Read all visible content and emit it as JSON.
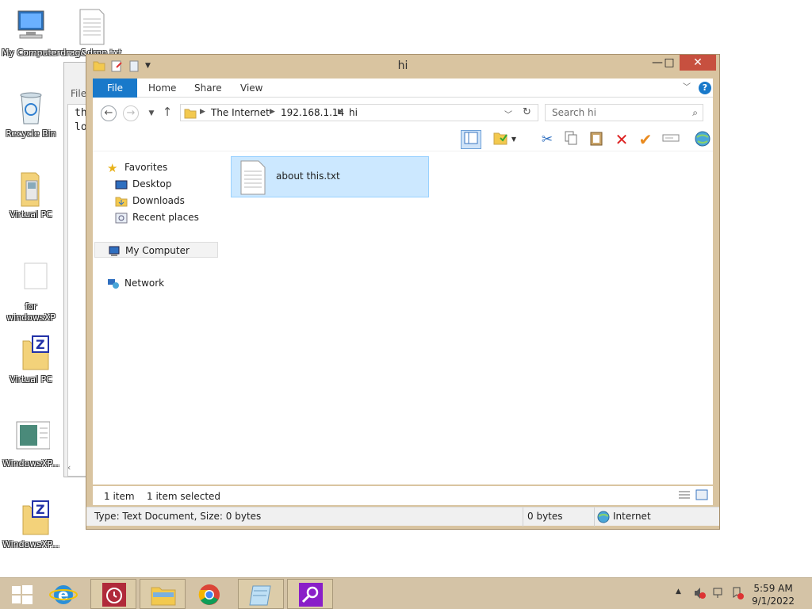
{
  "desktop": {
    "icons": [
      {
        "label": "My Computer"
      },
      {
        "label": "drag&drop.txt"
      },
      {
        "label": "Recycle Bin"
      },
      {
        "label": "Virtual PC"
      },
      {
        "label": "for windowsXP"
      },
      {
        "label": "Virtual PC"
      },
      {
        "label": "WindowsXP..."
      },
      {
        "label": "WindowsXP..."
      }
    ]
  },
  "notepad": {
    "menu": "File",
    "lines": [
      "th",
      "lo"
    ],
    "scroll_arrow": "‹"
  },
  "window": {
    "title": "hi",
    "controls": {
      "minimize": "—",
      "maximize": "□",
      "close": "✕"
    },
    "ribbon_tabs": [
      "File",
      "Home",
      "Share",
      "View"
    ],
    "address": {
      "crumbs": [
        "The Internet",
        "192.168.1.14",
        "hi"
      ],
      "search_placeholder": "Search hi"
    },
    "nav": {
      "favorites": "Favorites",
      "desktop": "Desktop",
      "downloads": "Downloads",
      "recent": "Recent places",
      "computer": "My Computer",
      "network": "Network"
    },
    "files": [
      {
        "name": "about this.txt"
      }
    ],
    "status": {
      "count": "1 item",
      "selected": "1 item selected"
    },
    "details": {
      "type": "Type: Text Document, Size: 0 bytes",
      "size": "0 bytes",
      "zone": "Internet"
    }
  },
  "taskbar": {
    "time": "5:59 AM",
    "date": "9/1/2022"
  },
  "colors": {
    "accent": "#1979ca",
    "frame": "#d9c4a0",
    "selection": "#cce8ff",
    "close": "#c7503f"
  }
}
